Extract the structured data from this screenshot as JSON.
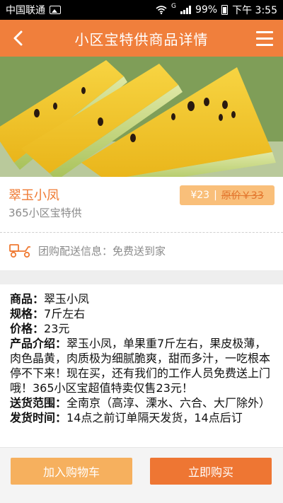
{
  "status_bar": {
    "carrier": "中国联通",
    "network": "G",
    "battery": "99%",
    "time": "下午 3:55"
  },
  "header": {
    "title": "小区宝特供商品详情"
  },
  "product": {
    "name": "翠玉小凤",
    "subtitle": "365小区宝特供",
    "price": "¥23",
    "price_separator": "|",
    "original_price": "原价￥33"
  },
  "delivery": {
    "text": "团购配送信息：免费送到家"
  },
  "details": {
    "name_label": "商品：",
    "name_value": "翠玉小凤",
    "spec_label": "规格：",
    "spec_value": "7斤左右",
    "price_label": "价格：",
    "price_value": "23元",
    "intro_label": "产品介绍：",
    "intro_value": "翠玉小凤，单果重7斤左右，果皮极薄，肉色晶黄，肉质极为细腻脆爽，甜而多汁，一吃根本停不下来！现在买，还有我们的工作人员免费送上门哦！365小区宝超值特卖仅售23元！",
    "range_label": "送货范围：",
    "range_value": "全南京（高淳、溧水、六合、大厂除外）",
    "ship_label": "发货时间：",
    "ship_value": "14点之前订单隔天发货，14点后订"
  },
  "actions": {
    "add_to_cart": "加入购物车",
    "buy_now": "立即购买"
  },
  "colors": {
    "accent": "#f07f3c",
    "price_tag": "#f9bf7a",
    "cart_button": "#f6b05e",
    "buy_button": "#ee7633"
  }
}
